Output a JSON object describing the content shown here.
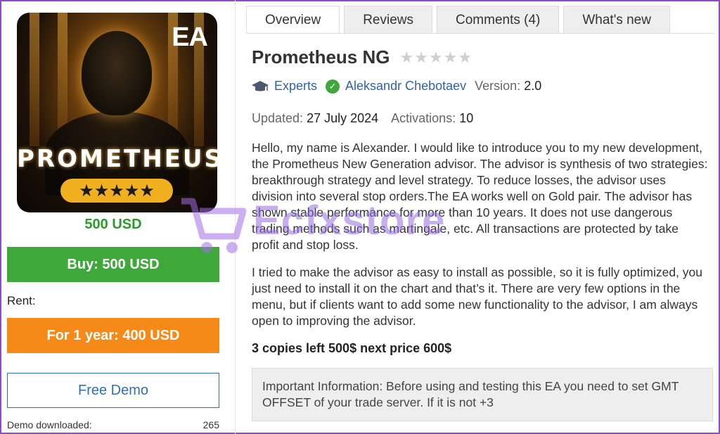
{
  "product": {
    "image_logo_text": "EA",
    "image_brand_text": "PROMETHEUS",
    "image_stars": "★★★★★",
    "price": "500 USD",
    "buy_label": "Buy: 500 USD",
    "rent_label": "Rent:",
    "rent_button": "For 1 year: 400 USD",
    "demo_button": "Free Demo",
    "demo_downloaded_label": "Demo downloaded:",
    "demo_downloaded_count": "265"
  },
  "tabs": [
    {
      "label": "Overview",
      "active": true
    },
    {
      "label": "Reviews",
      "active": false
    },
    {
      "label": "Comments (4)",
      "active": false
    },
    {
      "label": "What's new",
      "active": false
    }
  ],
  "details": {
    "title": "Prometheus NG",
    "rating_stars": "★★★★★",
    "category": "Experts",
    "author": "Aleksandr Chebotaev",
    "version_label": "Version:",
    "version_value": "2.0",
    "updated_label": "Updated:",
    "updated_value": "27 July 2024",
    "activations_label": "Activations:",
    "activations_value": "10"
  },
  "description": {
    "paragraph1": "Hello, my name is Alexander. I would like to introduce you to my new development, the Prometheus New Generation advisor. The advisor is synthesis of two strategies: breakthrough strategy and level strategy. To reduce losses, the advisor uses division into several stop orders.The EA works well on Gold  pair. The advisor has shown stable performance for more than 10 years. It does not use dangerous trading methods such as martingale, etc. All transactions are protected by take profit and stop loss.",
    "paragraph2": "I tried to make the advisor as easy to install as possible, so it is fully optimized, you just need to install it on the chart and that’s it. There are very few options in the menu, but if clients want to add some new functionality to the advisor, I am always open to improving the advisor.",
    "copies_note": "3 copies left 500$ next price 600$",
    "important_info": "Important Information: Before using and testing this EA you need to set  GMT OFFSET of your trade server. If it is not +3"
  },
  "watermark": {
    "text": "Ecfxstore"
  },
  "colors": {
    "frame": "#8a4cc8",
    "buy": "#3fa83a",
    "rent": "#f58a18",
    "link": "#2f63a8",
    "price": "#2a9a2a"
  }
}
